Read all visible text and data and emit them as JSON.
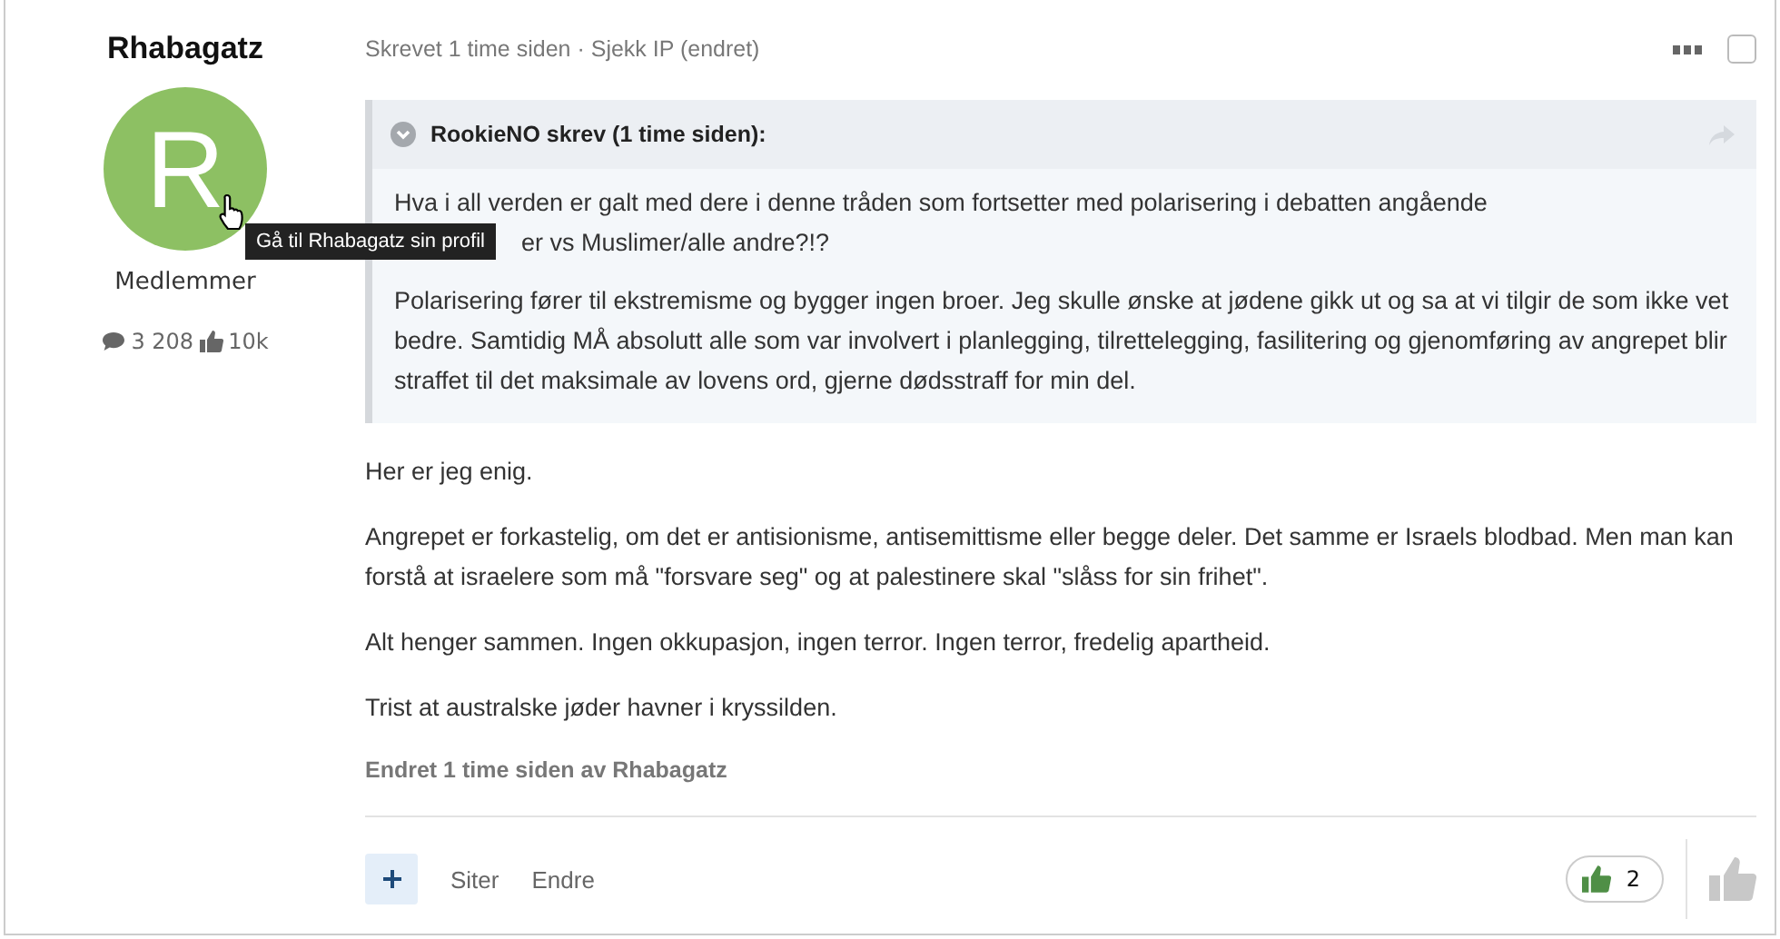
{
  "author": {
    "name": "Rhabagatz",
    "initial": "R",
    "group": "Medlemmer",
    "posts": "3 208",
    "reputation": "10k"
  },
  "tooltip": "Gå til Rhabagatz sin profil",
  "meta": "Skrevet 1 time siden · Sjekk IP (endret)",
  "post_checkbox": {
    "checked": false
  },
  "quote": {
    "header": "RookieNO skrev (1 time siden):",
    "lines": [
      "Hva i all verden er galt med dere i denne tråden som fortsetter med polarisering i debatten angående",
      "er vs Muslimer/alle andre?!?"
    ],
    "paragraphs": [
      "Polarisering fører til ekstremisme og bygger ingen broer. Jeg skulle ønske at jødene gikk ut og sa at vi tilgir de som ikke vet bedre. Samtidig MÅ absolutt alle som var involvert i planlegging, tilrettelegging, fasilitering og gjenomføring av angrepet blir straffet til det maksimale av lovens ord, gjerne dødsstraff for min del."
    ]
  },
  "paragraphs": [
    "Her er jeg enig.",
    "Angrepet er forkastelig, om det er antisionisme, antisemittisme eller begge deler. Det samme er Israels blodbad. Men man kan forstå at israelere som må \"forsvare seg\" og at palestinere skal \"slåss for sin frihet\".",
    "Alt henger sammen. Ingen okkupasjon, ingen terror. Ingen terror, fredelig apartheid.",
    "Trist at australske jøder havner i kryssilden."
  ],
  "edited": "Endret 1 time siden av Rhabagatz",
  "actions": [
    "Siter",
    "Endre"
  ],
  "reaction_count": "2"
}
